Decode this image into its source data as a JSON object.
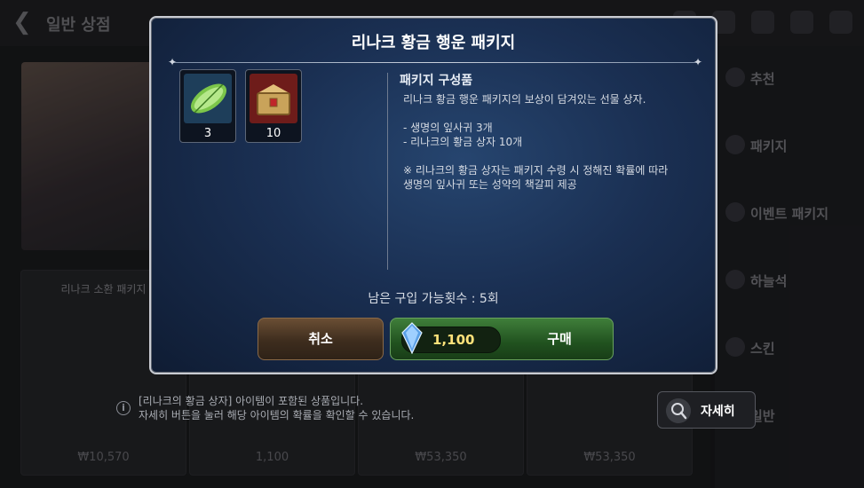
{
  "background": {
    "header_title": "일반 상점",
    "cards": [
      {
        "caption": "리나크 소환 패키지",
        "price": "₩10,570"
      },
      {
        "caption": "",
        "price": "1,100"
      },
      {
        "caption": "",
        "price": "₩53,350"
      },
      {
        "caption": "",
        "price": "₩53,350"
      }
    ],
    "sidebar": [
      "추천",
      "패키지",
      "이벤트 패키지",
      "하늘석",
      "스킨",
      "일반"
    ]
  },
  "modal": {
    "title": "리나크 황금 행운 패키지",
    "items": [
      {
        "icon": "leaf-icon",
        "count": "3"
      },
      {
        "icon": "golden-chest-icon",
        "count": "10"
      }
    ],
    "description_title": "패키지 구성품",
    "description_body": "리나크 황금 행운 패키지의 보상이 담겨있는 선물 상자.\n\n- 생명의 잎사귀 3개\n- 리나크의 황금 상자 10개\n\n※ 리나크의 황금 상자는 패키지 수령 시 정해진 확률에 따라\n생명의 잎사귀 또는 성약의 책갈피 제공",
    "remaining": "남은 구입 가능횟수 : 5회",
    "cancel_label": "취소",
    "price": "1,100",
    "currency_icon": "sky-stone-gem-icon",
    "buy_label": "구매"
  },
  "footer": {
    "info_text": "[리나크의 황금 상자] 아이템이 포함된 상품입니다.\n자세히 버튼을 눌러 해당 아이템의 확률을 확인할 수 있습니다.",
    "detail_label": "자세히"
  },
  "colors": {
    "price_text": "#ffe27a",
    "buy_button": "#2f6a2c",
    "cancel_button": "#5a412b",
    "modal_bg": "#1a2f52"
  }
}
